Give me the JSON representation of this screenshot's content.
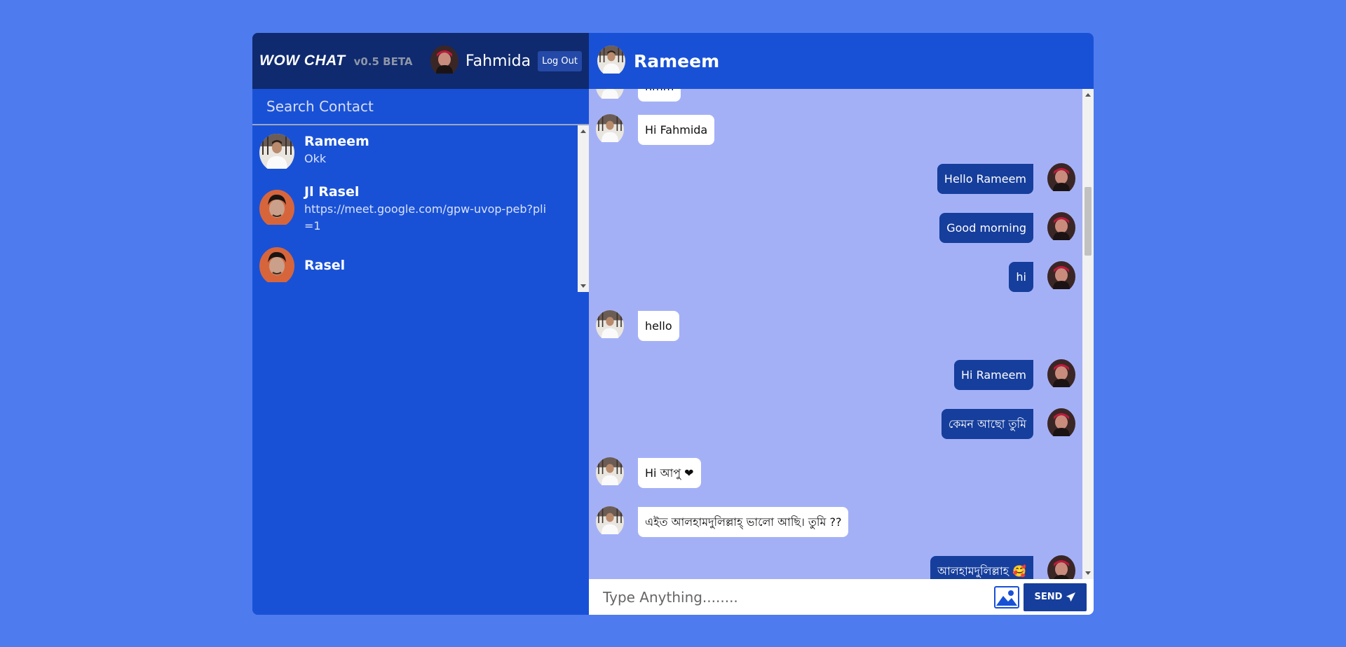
{
  "app": {
    "brand": "WOW CHAT",
    "version": "v0.5 BETA"
  },
  "user": {
    "name": "Fahmida",
    "logout_label": "Log Out"
  },
  "search": {
    "placeholder": "Search Contact"
  },
  "contacts": [
    {
      "name": "Rameem",
      "last_message": "Okk"
    },
    {
      "name": "Jl Rasel",
      "last_message": "https://meet.google.com/gpw-uvop-peb?pli=1"
    },
    {
      "name": "Rasel",
      "last_message": ""
    }
  ],
  "chat": {
    "title": "Rameem",
    "messages": [
      {
        "direction": "in",
        "text": "hmm"
      },
      {
        "direction": "in",
        "text": "Hi Fahmida"
      },
      {
        "direction": "out",
        "text": "Hello Rameem"
      },
      {
        "direction": "out",
        "text": "Good morning"
      },
      {
        "direction": "out",
        "text": "hi"
      },
      {
        "direction": "in",
        "text": "hello"
      },
      {
        "direction": "out",
        "text": "Hi Rameem"
      },
      {
        "direction": "out",
        "text": "কেমন আছো তুমি"
      },
      {
        "direction": "in",
        "text": "Hi আপু ❤"
      },
      {
        "direction": "in",
        "text": "এইত আলহামদুলিল্লাহ্ ভালো আছি। তুমি ??"
      },
      {
        "direction": "out",
        "text": "আলহামদুলিল্লাহ 🥰"
      }
    ]
  },
  "composer": {
    "placeholder": "Type Anything........",
    "send_label": "SEND"
  },
  "icons": {
    "image": "image-icon",
    "send": "paper-plane-icon"
  },
  "colors": {
    "page_bg": "#4e7bee",
    "header_dark": "#0f2a6e",
    "panel_blue": "#1951d6",
    "chat_bg": "#a4b0f6",
    "outgoing_bubble": "#163e9c",
    "incoming_bubble": "#ffffff"
  }
}
